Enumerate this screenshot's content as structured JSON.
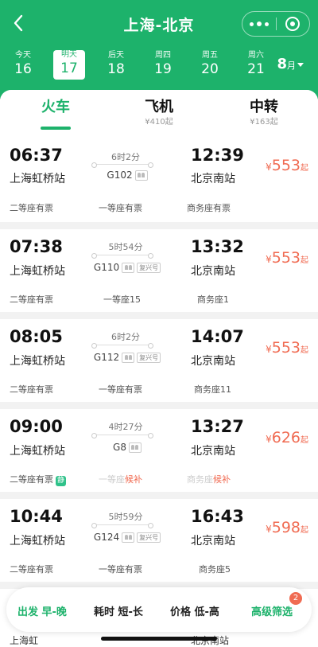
{
  "title": "上海-北京",
  "dates": [
    {
      "weekday": "今天",
      "day": "16",
      "active": false
    },
    {
      "weekday": "明天",
      "day": "17",
      "active": true
    },
    {
      "weekday": "后天",
      "day": "18",
      "active": false
    },
    {
      "weekday": "周四",
      "day": "19",
      "active": false
    },
    {
      "weekday": "周五",
      "day": "20",
      "active": false
    },
    {
      "weekday": "周六",
      "day": "21",
      "active": false
    }
  ],
  "month": {
    "number": "8",
    "unit": "月"
  },
  "modes": [
    {
      "label": "火车",
      "sub": "",
      "active": true
    },
    {
      "label": "飞机",
      "sub": "¥410起",
      "active": false
    },
    {
      "label": "中转",
      "sub": "¥163起",
      "active": false
    }
  ],
  "trains": [
    {
      "depart": "06:37",
      "from": "上海虹桥站",
      "duration": "6时2分",
      "train_no": "G102",
      "fuxing": "",
      "arrive": "12:39",
      "to": "北京南站",
      "currency": "¥",
      "price": "553",
      "price_suffix": "起",
      "seats": [
        {
          "name": "二等座",
          "status": "有票"
        },
        {
          "name": "一等座",
          "status": "有票"
        },
        {
          "name": "商务座",
          "status": "有票"
        }
      ]
    },
    {
      "depart": "07:38",
      "from": "上海虹桥站",
      "duration": "5时54分",
      "train_no": "G110",
      "fuxing": "复兴号",
      "arrive": "13:32",
      "to": "北京南站",
      "currency": "¥",
      "price": "553",
      "price_suffix": "起",
      "seats": [
        {
          "name": "二等座",
          "status": "有票"
        },
        {
          "name": "一等座",
          "status": "15"
        },
        {
          "name": "商务座",
          "status": "1"
        }
      ]
    },
    {
      "depart": "08:05",
      "from": "上海虹桥站",
      "duration": "6时2分",
      "train_no": "G112",
      "fuxing": "复兴号",
      "arrive": "14:07",
      "to": "北京南站",
      "currency": "¥",
      "price": "553",
      "price_suffix": "起",
      "seats": [
        {
          "name": "二等座",
          "status": "有票"
        },
        {
          "name": "一等座",
          "status": "有票"
        },
        {
          "name": "商务座",
          "status": "11"
        }
      ]
    },
    {
      "depart": "09:00",
      "from": "上海虹桥站",
      "duration": "4时27分",
      "train_no": "G8",
      "fuxing": "",
      "arrive": "13:27",
      "to": "北京南站",
      "currency": "¥",
      "price": "626",
      "price_suffix": "起",
      "seats": [
        {
          "name": "二等座",
          "status": "有票",
          "tag": "静"
        },
        {
          "name": "一等座",
          "status": "候补"
        },
        {
          "name": "商务座",
          "status": "候补"
        }
      ]
    },
    {
      "depart": "10:44",
      "from": "上海虹桥站",
      "duration": "5时59分",
      "train_no": "G124",
      "fuxing": "复兴号",
      "arrive": "16:43",
      "to": "北京南站",
      "currency": "¥",
      "price": "598",
      "price_suffix": "起",
      "seats": [
        {
          "name": "二等座",
          "status": "有票"
        },
        {
          "name": "一等座",
          "status": "有票"
        },
        {
          "name": "商务座",
          "status": "5"
        }
      ]
    }
  ],
  "filters": [
    {
      "label": "出发 早-晚"
    },
    {
      "label": "耗时 短-长"
    },
    {
      "label": "价格 低-高"
    },
    {
      "label": "高级筛选",
      "badge": "2"
    }
  ],
  "peek": {
    "from": "上海虹",
    "to": "北京南站"
  },
  "colors": {
    "brand": "#1db26b",
    "price": "#f06b52"
  }
}
